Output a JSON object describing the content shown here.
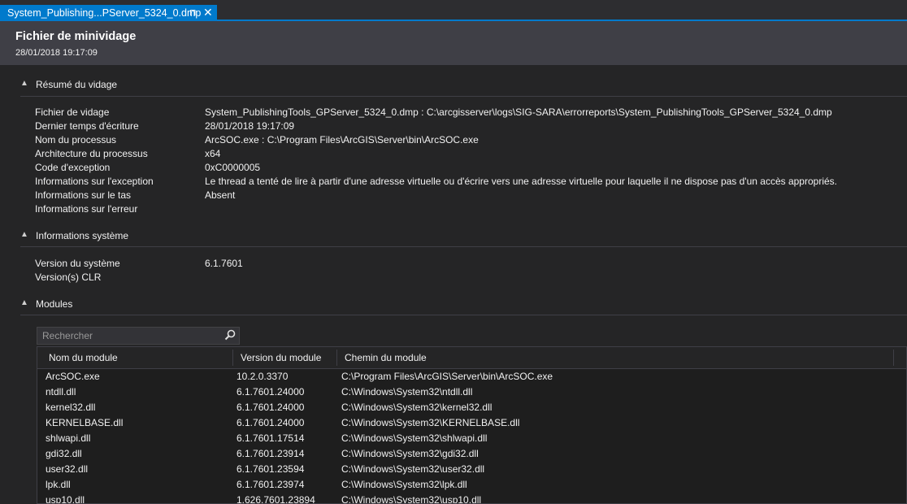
{
  "tab": {
    "title": "System_Publishing...PServer_5324_0.dmp",
    "pin_glyph": "⊓",
    "close_glyph": "✕"
  },
  "header": {
    "title": "Fichier de minividage",
    "date": "28/01/2018 19:17:09"
  },
  "sections": {
    "summary": {
      "label": "Résumé du vidage",
      "items": [
        {
          "key": "Fichier de vidage",
          "value": "System_PublishingTools_GPServer_5324_0.dmp : C:\\arcgisserver\\logs\\SIG-SARA\\errorreports\\System_PublishingTools_GPServer_5324_0.dmp"
        },
        {
          "key": "Dernier temps d'écriture",
          "value": "28/01/2018 19:17:09"
        },
        {
          "key": "Nom du processus",
          "value": "ArcSOC.exe : C:\\Program Files\\ArcGIS\\Server\\bin\\ArcSOC.exe"
        },
        {
          "key": "Architecture du processus",
          "value": "x64"
        },
        {
          "key": "Code d'exception",
          "value": "0xC0000005"
        },
        {
          "key": "Informations sur l'exception",
          "value": "Le thread a tenté de lire à partir d'une adresse virtuelle ou d'écrire vers une adresse virtuelle pour laquelle il ne dispose pas d'un accès appropriés."
        },
        {
          "key": "Informations sur le tas",
          "value": "Absent"
        },
        {
          "key": "Informations sur l'erreur",
          "value": ""
        }
      ]
    },
    "system": {
      "label": "Informations système",
      "items": [
        {
          "key": "Version du système",
          "value": "6.1.7601"
        },
        {
          "key": "Version(s) CLR",
          "value": ""
        }
      ]
    },
    "modules": {
      "label": "Modules",
      "search_placeholder": "Rechercher",
      "columns": [
        "Nom du module",
        "Version du module",
        "Chemin du module"
      ],
      "rows": [
        [
          "ArcSOC.exe",
          "10.2.0.3370",
          "C:\\Program Files\\ArcGIS\\Server\\bin\\ArcSOC.exe"
        ],
        [
          "ntdll.dll",
          "6.1.7601.24000",
          "C:\\Windows\\System32\\ntdll.dll"
        ],
        [
          "kernel32.dll",
          "6.1.7601.24000",
          "C:\\Windows\\System32\\kernel32.dll"
        ],
        [
          "KERNELBASE.dll",
          "6.1.7601.24000",
          "C:\\Windows\\System32\\KERNELBASE.dll"
        ],
        [
          "shlwapi.dll",
          "6.1.7601.17514",
          "C:\\Windows\\System32\\shlwapi.dll"
        ],
        [
          "gdi32.dll",
          "6.1.7601.23914",
          "C:\\Windows\\System32\\gdi32.dll"
        ],
        [
          "user32.dll",
          "6.1.7601.23594",
          "C:\\Windows\\System32\\user32.dll"
        ],
        [
          "lpk.dll",
          "6.1.7601.23974",
          "C:\\Windows\\System32\\lpk.dll"
        ],
        [
          "usp10.dll",
          "1.626.7601.23894",
          "C:\\Windows\\System32\\usp10.dll"
        ]
      ]
    }
  },
  "colors": {
    "accent": "#007acc",
    "background": "#252526",
    "header": "#3f3f46"
  }
}
